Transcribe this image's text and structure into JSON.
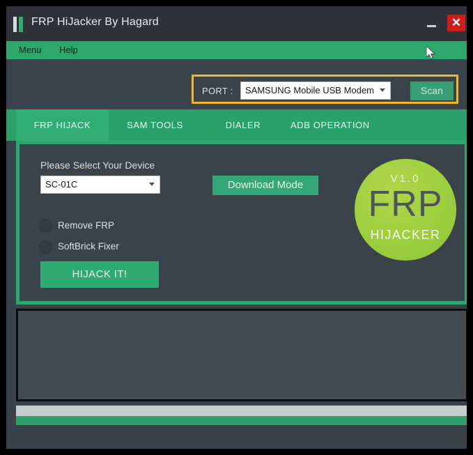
{
  "window": {
    "title": "FRP HiJacker By Hagard",
    "icon": "app-bars-icon",
    "minimize_label": "–",
    "close_label": "✕"
  },
  "menubar": {
    "items": [
      {
        "label": "Menu"
      },
      {
        "label": "Help"
      }
    ]
  },
  "port": {
    "label": "PORT :",
    "selected": "SAMSUNG Mobile USB Modem (",
    "scan_label": "Scan",
    "annotation_color": "#f0b822"
  },
  "tabs": [
    {
      "label": "FRP HIJACK",
      "active": true
    },
    {
      "label": "SAM TOOLS",
      "active": false
    },
    {
      "label": "DIALER",
      "active": false
    },
    {
      "label": "ADB OPERATION",
      "active": false
    }
  ],
  "frp_hijack": {
    "device_label": "Please Select Your Device",
    "device_selected": "SC-01C",
    "download_mode_label": "Download Mode",
    "options": [
      {
        "label": "Remove FRP",
        "selected": false
      },
      {
        "label": "SoftBrick Fixer",
        "selected": false
      }
    ],
    "hijack_label": "HIJACK IT!"
  },
  "logo": {
    "version": "V1.0",
    "title": "FRP",
    "subtitle": "HIJACKER",
    "color": "#9ccf3e"
  },
  "log": {
    "text": ""
  },
  "status": {
    "text": "",
    "progress_percent": 0
  },
  "theme": {
    "accent_green": "#2ba86e",
    "panel_dark": "#3b434a",
    "title_dark": "#2f3338",
    "close_red": "#d11c1c"
  }
}
